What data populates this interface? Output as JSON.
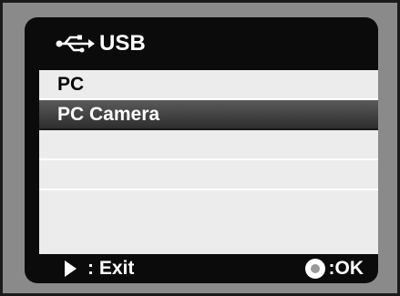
{
  "header": {
    "icon": "usb-icon",
    "title": "USB"
  },
  "menu": {
    "items": [
      {
        "label": "PC",
        "selected": false
      },
      {
        "label": "PC Camera",
        "selected": true
      },
      {
        "label": "",
        "selected": false
      },
      {
        "label": "",
        "selected": false
      },
      {
        "label": "",
        "selected": false
      }
    ]
  },
  "footer": {
    "exit_icon": "play-icon",
    "exit_label": ": Exit",
    "ok_icon": "ok-button-icon",
    "ok_label": ":OK"
  },
  "colors": {
    "screen_bg": "#0b0b0b",
    "menu_bg": "#ececec",
    "selected_bg": "#3a3a3a",
    "frame_bg": "#8a8a8a"
  }
}
